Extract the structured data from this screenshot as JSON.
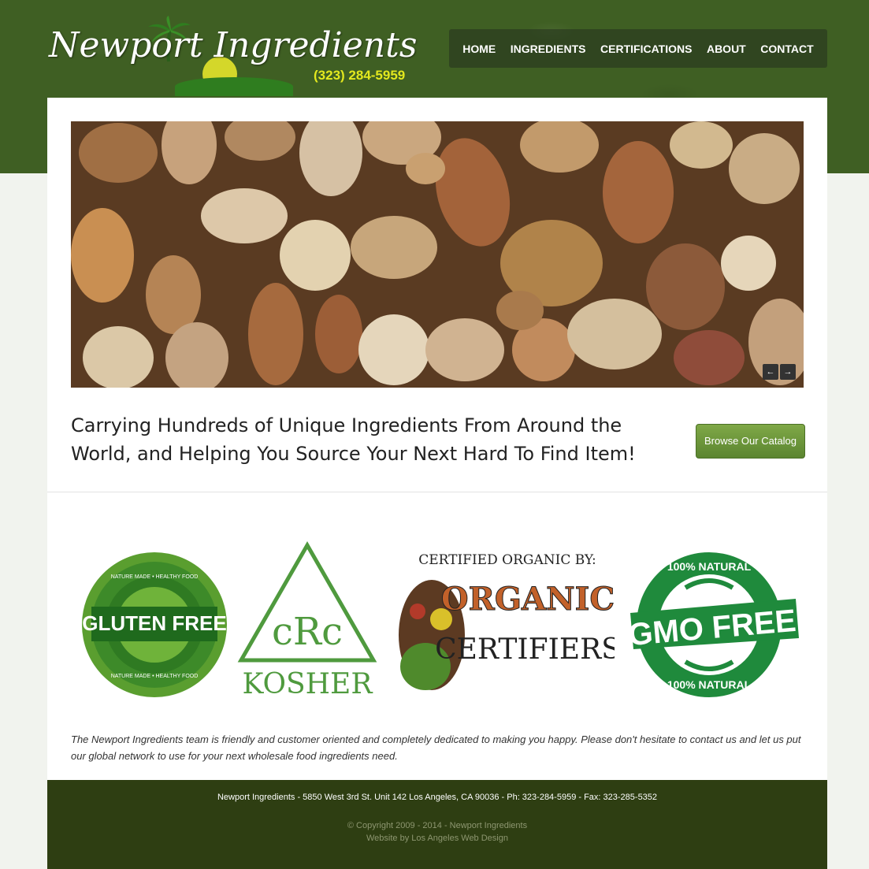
{
  "header": {
    "logo_text": "Newport Ingredients",
    "phone": "(323) 284-5959"
  },
  "nav": {
    "items": [
      "HOME",
      "INGREDIENTS",
      "CERTIFICATIONS",
      "ABOUT",
      "CONTACT"
    ]
  },
  "slider": {
    "image": "mixed-nuts-photo",
    "prev_icon": "←",
    "next_icon": "→"
  },
  "tagline": "Carrying Hundreds of Unique Ingredients From Around the World, and Helping You Source Your Next Hard To Find Item!",
  "cta_label": "Browse Our Catalog",
  "certifications": {
    "gluten": {
      "title": "GLUTEN FREE",
      "ring_top": "NATURE MADE • HEALTHY FOOD",
      "ring_bottom": "NATURE MADE • HEALTHY FOOD"
    },
    "kosher": {
      "mark": "cRc",
      "label": "KOSHER"
    },
    "organic": {
      "heading": "CERTIFIED ORGANIC BY:",
      "word1": "ORGANIC",
      "word2": "CERTIFIERS"
    },
    "gmo": {
      "title": "GMO FREE",
      "ring_top": "100% NATURAL",
      "ring_bottom": "100% NATURAL"
    }
  },
  "blurb": "The Newport Ingredients team is friendly and customer oriented and completely dedicated to making you happy. Please don't hesitate to contact us and let us put our global network to use for your next wholesale food ingredients need.",
  "footer": {
    "address": "Newport Ingredients - 5850 West 3rd St. Unit 142 Los Angeles, CA 90036 - Ph: 323-284-5959 - Fax: 323-285-5352",
    "copyright": "© Copyright 2009 - 2014 - Newport Ingredients",
    "credit": "Website by Los Angeles Web Design"
  },
  "colors": {
    "header_green": "#3f5f23",
    "footer_green": "#2e3e12",
    "phone_yellow": "#e3e81e",
    "cta_green": "#6a9439"
  }
}
